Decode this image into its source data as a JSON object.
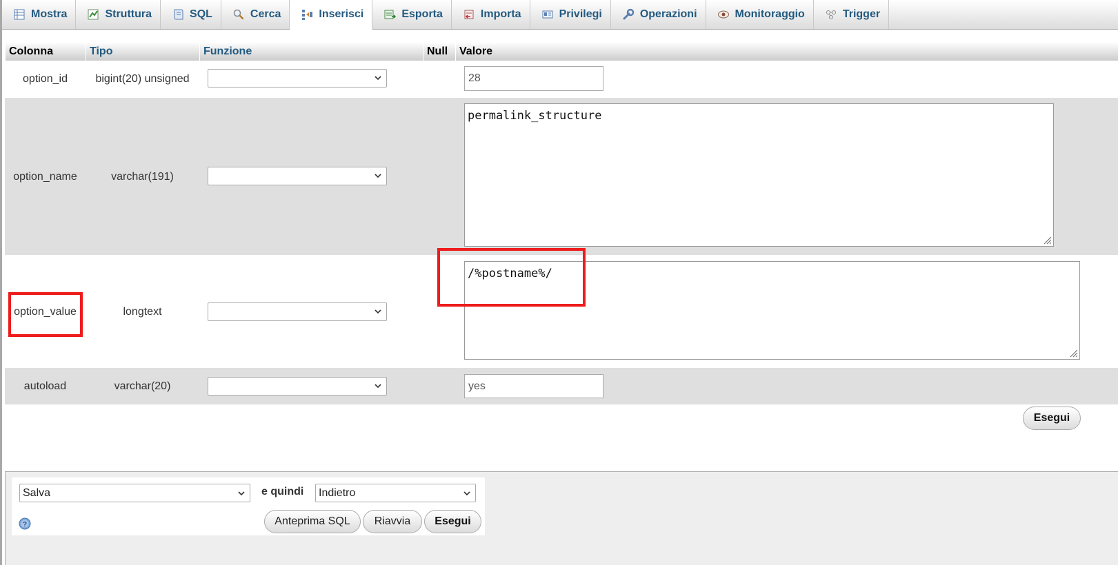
{
  "tabs": [
    {
      "label": "Mostra",
      "icon": "browse-icon"
    },
    {
      "label": "Struttura",
      "icon": "structure-icon"
    },
    {
      "label": "SQL",
      "icon": "sql-icon"
    },
    {
      "label": "Cerca",
      "icon": "search-icon"
    },
    {
      "label": "Inserisci",
      "icon": "insert-icon",
      "active": true
    },
    {
      "label": "Esporta",
      "icon": "export-icon"
    },
    {
      "label": "Importa",
      "icon": "import-icon"
    },
    {
      "label": "Privilegi",
      "icon": "privileges-icon"
    },
    {
      "label": "Operazioni",
      "icon": "wrench-icon"
    },
    {
      "label": "Monitoraggio",
      "icon": "eye-icon"
    },
    {
      "label": "Trigger",
      "icon": "trigger-icon"
    }
  ],
  "table": {
    "headers": {
      "column": "Colonna",
      "type": "Tipo",
      "function": "Funzione",
      "null": "Null",
      "value": "Valore"
    },
    "rows": [
      {
        "column": "option_id",
        "type": "bigint(20) unsigned",
        "function": "",
        "value": "28"
      },
      {
        "column": "option_name",
        "type": "varchar(191)",
        "function": "",
        "value": "permalink_structure"
      },
      {
        "column": "option_value",
        "type": "longtext",
        "function": "",
        "value": "/%postname%/"
      },
      {
        "column": "autoload",
        "type": "varchar(20)",
        "function": "",
        "value": "yes"
      }
    ]
  },
  "go_button": "Esegui",
  "bottom": {
    "action_select": "Salva",
    "then_label": "e quindi",
    "after_select": "Indietro",
    "preview_sql": "Anteprima SQL",
    "reset": "Riavvia",
    "go": "Esegui"
  },
  "colors": {
    "accent": "#235a81",
    "highlight": "#ee1c1c"
  }
}
